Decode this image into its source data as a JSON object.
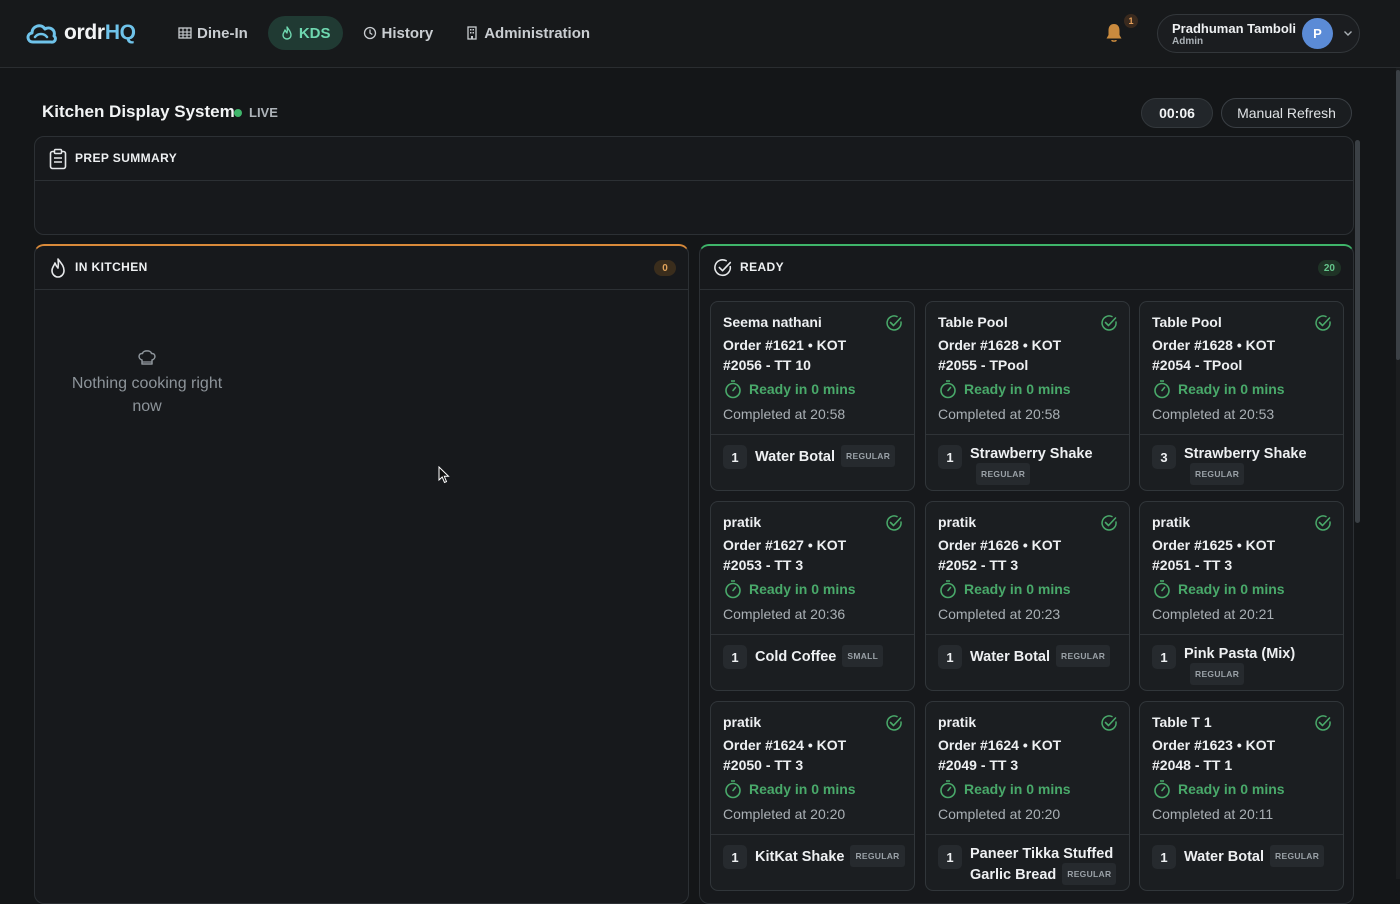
{
  "brand": {
    "name_part1": "ordr",
    "name_part2": "HQ",
    "accent": "#6fc3ea"
  },
  "nav": {
    "items": [
      {
        "label": "Dine-In",
        "icon": "table-icon",
        "active": false
      },
      {
        "label": "KDS",
        "icon": "flame-icon",
        "active": true
      },
      {
        "label": "History",
        "icon": "clock-icon",
        "active": false
      },
      {
        "label": "Administration",
        "icon": "building-icon",
        "active": false
      }
    ]
  },
  "notifications": {
    "count": "1"
  },
  "user": {
    "name": "Pradhuman Tamboli",
    "role": "Admin",
    "initial": "P"
  },
  "header": {
    "title": "Kitchen Display System",
    "live": "LIVE",
    "timer": "00:06",
    "refresh_label": "Manual Refresh"
  },
  "prep": {
    "title": "PREP SUMMARY"
  },
  "kitchen": {
    "title": "IN KITCHEN",
    "count": "0",
    "empty_text": "Nothing cooking right now",
    "accent": "#d98a3a"
  },
  "ready": {
    "title": "READY",
    "count": "20",
    "accent": "#3fb56a",
    "cards": [
      {
        "name": "Seema nathani",
        "order": "Order #1621 • KOT #2056 - TT 10",
        "eta": "Ready in 0 mins",
        "completed": "Completed at 20:58",
        "qty": "1",
        "item": "Water Botal",
        "variant": "REGULAR"
      },
      {
        "name": "Table Pool",
        "order": "Order #1628 • KOT #2055 - TPool",
        "eta": "Ready in 0 mins",
        "completed": "Completed at 20:58",
        "qty": "1",
        "item": "Strawberry Shake",
        "variant": "REGULAR"
      },
      {
        "name": "Table Pool",
        "order": "Order #1628 • KOT #2054 - TPool",
        "eta": "Ready in 0 mins",
        "completed": "Completed at 20:53",
        "qty": "3",
        "item": "Strawberry Shake",
        "variant": "REGULAR"
      },
      {
        "name": "pratik",
        "order": "Order #1627 • KOT #2053 - TT 3",
        "eta": "Ready in 0 mins",
        "completed": "Completed at 20:36",
        "qty": "1",
        "item": "Cold Coffee",
        "variant": "SMALL"
      },
      {
        "name": "pratik",
        "order": "Order #1626 • KOT #2052 - TT 3",
        "eta": "Ready in 0 mins",
        "completed": "Completed at 20:23",
        "qty": "1",
        "item": "Water Botal",
        "variant": "REGULAR"
      },
      {
        "name": "pratik",
        "order": "Order #1625 • KOT #2051 - TT 3",
        "eta": "Ready in 0 mins",
        "completed": "Completed at 20:21",
        "qty": "1",
        "item": "Pink Pasta (Mix)",
        "variant": "REGULAR"
      },
      {
        "name": "pratik",
        "order": "Order #1624 • KOT #2050 - TT 3",
        "eta": "Ready in 0 mins",
        "completed": "Completed at 20:20",
        "qty": "1",
        "item": "KitKat Shake",
        "variant": "REGULAR"
      },
      {
        "name": "pratik",
        "order": "Order #1624 • KOT #2049 - TT 3",
        "eta": "Ready in 0 mins",
        "completed": "Completed at 20:20",
        "qty": "1",
        "item": "Paneer Tikka Stuffed Garlic Bread",
        "variant": "REGULAR"
      },
      {
        "name": "Table T 1",
        "order": "Order #1623 • KOT #2048 - TT 1",
        "eta": "Ready in 0 mins",
        "completed": "Completed at 20:11",
        "qty": "1",
        "item": "Water Botal",
        "variant": "REGULAR"
      }
    ]
  }
}
